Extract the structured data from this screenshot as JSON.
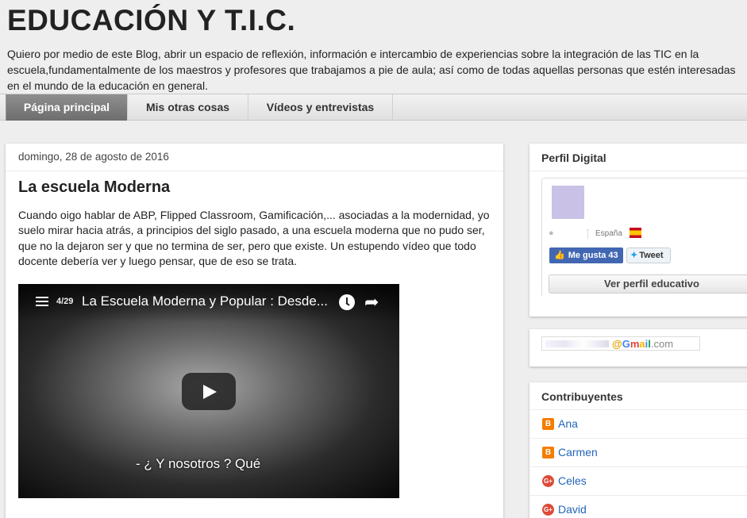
{
  "header": {
    "title": "EDUCACIÓN Y T.I.C.",
    "description": "Quiero por medio de este Blog, abrir un espacio de reflexión, información e intercambio de experiencias sobre la integración de las TIC en la escuela,fundamentalmente de los maestros y profesores que trabajamos a pie de aula; así como de todas aquellas personas que estén interesadas en el mundo de la educación en general."
  },
  "tabs": [
    {
      "label": "Página principal",
      "active": true
    },
    {
      "label": "Mis otras cosas",
      "active": false
    },
    {
      "label": "Vídeos y entrevistas",
      "active": false
    }
  ],
  "post": {
    "date": "domingo, 28 de agosto de 2016",
    "title": "La escuela Moderna",
    "body": "Cuando oigo hablar de ABP, Flipped Classroom, Gamificación,... asociadas a la modernidad, yo suelo mirar hacia atrás, a principios del siglo pasado, a una escuela moderna que no pudo ser, que no la dejaron ser y que no termina de ser, pero que existe. Un estupendo vídeo que todo docente debería ver y luego pensar, que de eso se trata.",
    "video": {
      "count": "4/29",
      "title": "La Escuela Moderna y Popular : Desde...",
      "subtitle": "- ¿ Y nosotros ? Qué",
      "icons": [
        "playlist-icon",
        "clock-icon",
        "share-icon",
        "play-icon"
      ]
    }
  },
  "sidebar": {
    "perfil": {
      "title": "Perfil Digital",
      "country": "España",
      "like_label": "Me gusta 43",
      "tweet_label": "Tweet",
      "button_label": "Ver perfil educativo"
    },
    "email": {
      "at": "@",
      "g": "G",
      "m": "m",
      "a": "a",
      "i": "i",
      "l": "l",
      "com": ".com"
    },
    "contributors": {
      "title": "Contribuyentes",
      "items": [
        {
          "name": "Ana",
          "icon": "blogger-icon"
        },
        {
          "name": "Carmen",
          "icon": "blogger-icon"
        },
        {
          "name": "Celes",
          "icon": "google-plus-icon"
        },
        {
          "name": "David",
          "icon": "google-plus-icon"
        }
      ]
    }
  },
  "colors": {
    "accent_link": "#2266bb",
    "tab_active": "#7a7a7a",
    "facebook": "#4267b2",
    "blogger": "#f57d00",
    "google_plus": "#dd4b39"
  }
}
